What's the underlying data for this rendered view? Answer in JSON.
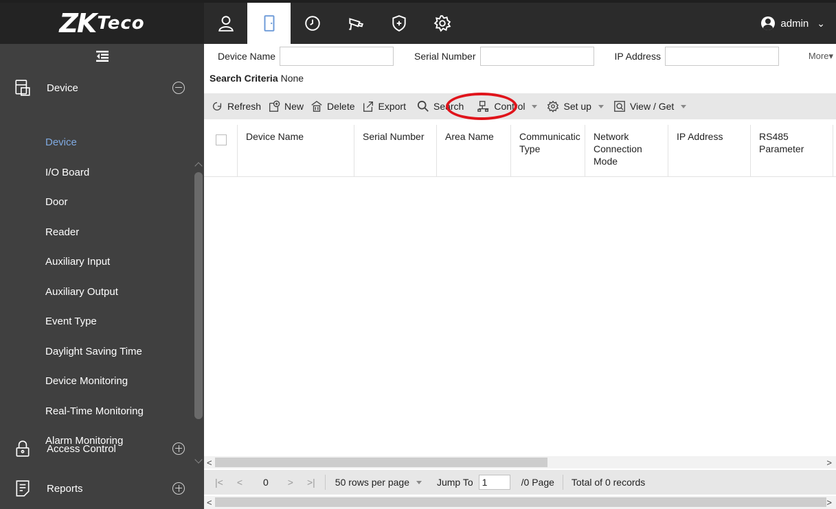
{
  "brand": {
    "logo_main": "ZK",
    "logo_sub": "Teco"
  },
  "topbar": {
    "modules": [
      {
        "name": "personnel",
        "icon": "person-icon"
      },
      {
        "name": "access",
        "icon": "door-icon"
      },
      {
        "name": "attendance",
        "icon": "clock-icon"
      },
      {
        "name": "video",
        "icon": "camera-icon"
      },
      {
        "name": "security",
        "icon": "shield-icon"
      },
      {
        "name": "system",
        "icon": "gear-icon"
      }
    ],
    "active_module": 1,
    "user": {
      "name": "admin",
      "caret": "⌄"
    }
  },
  "sidebar": {
    "groups": [
      {
        "label": "Device",
        "toggle": "minus"
      },
      {
        "label": "Access Control",
        "toggle": "plus"
      },
      {
        "label": "Reports",
        "toggle": "plus"
      }
    ],
    "items": [
      "Device",
      "I/O Board",
      "Door",
      "Reader",
      "Auxiliary Input",
      "Auxiliary Output",
      "Event Type",
      "Daylight Saving Time",
      "Device Monitoring",
      "Real-Time Monitoring",
      "Alarm Monitoring"
    ],
    "active_item": 0
  },
  "filters": {
    "device_name_label": "Device Name",
    "serial_number_label": "Serial Number",
    "ip_address_label": "IP Address",
    "more_label": "More▾"
  },
  "criteria": {
    "label": "Search Criteria",
    "value": "None"
  },
  "toolbar": {
    "refresh": "Refresh",
    "new": "New",
    "delete": "Delete",
    "export": "Export",
    "search": "Search",
    "control": "Control",
    "setup": "Set up",
    "viewget": "View / Get"
  },
  "table": {
    "columns": [
      "Device Name",
      "Serial Number",
      "Area Name",
      "Communicatic Type",
      "Network Connection Mode",
      "IP Address",
      "RS485 Parameter"
    ],
    "rows": []
  },
  "pager": {
    "first": "|<",
    "prev": "<",
    "current": "0",
    "next": ">",
    "last": ">|",
    "rows_per_page": "50 rows per page",
    "jump_label": "Jump To",
    "jump_value": "1",
    "page_suffix": "/0 Page",
    "total": "Total of 0 records"
  },
  "scroll": {
    "left_arrow": "<",
    "right_arrow": ">"
  }
}
